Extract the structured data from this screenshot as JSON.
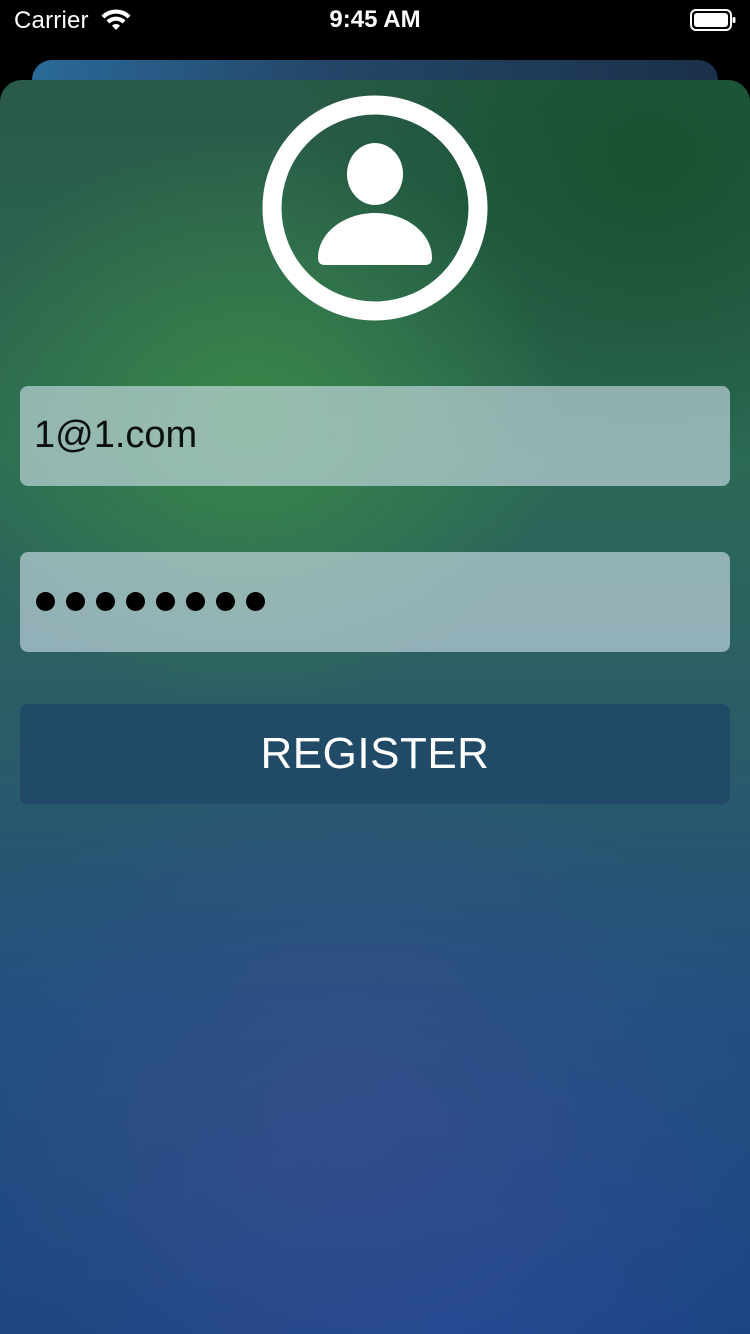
{
  "status_bar": {
    "carrier": "Carrier",
    "time": "9:45 AM",
    "wifi_icon": "wifi-icon",
    "battery_icon": "battery-icon"
  },
  "form": {
    "avatar_icon": "user-circle-icon",
    "email_value": "1@1.com",
    "password_length": 8,
    "register_label": "REGISTER"
  },
  "colors": {
    "button": "#1e4866",
    "field": "#d2e1eb",
    "text_light": "#ffffff"
  }
}
